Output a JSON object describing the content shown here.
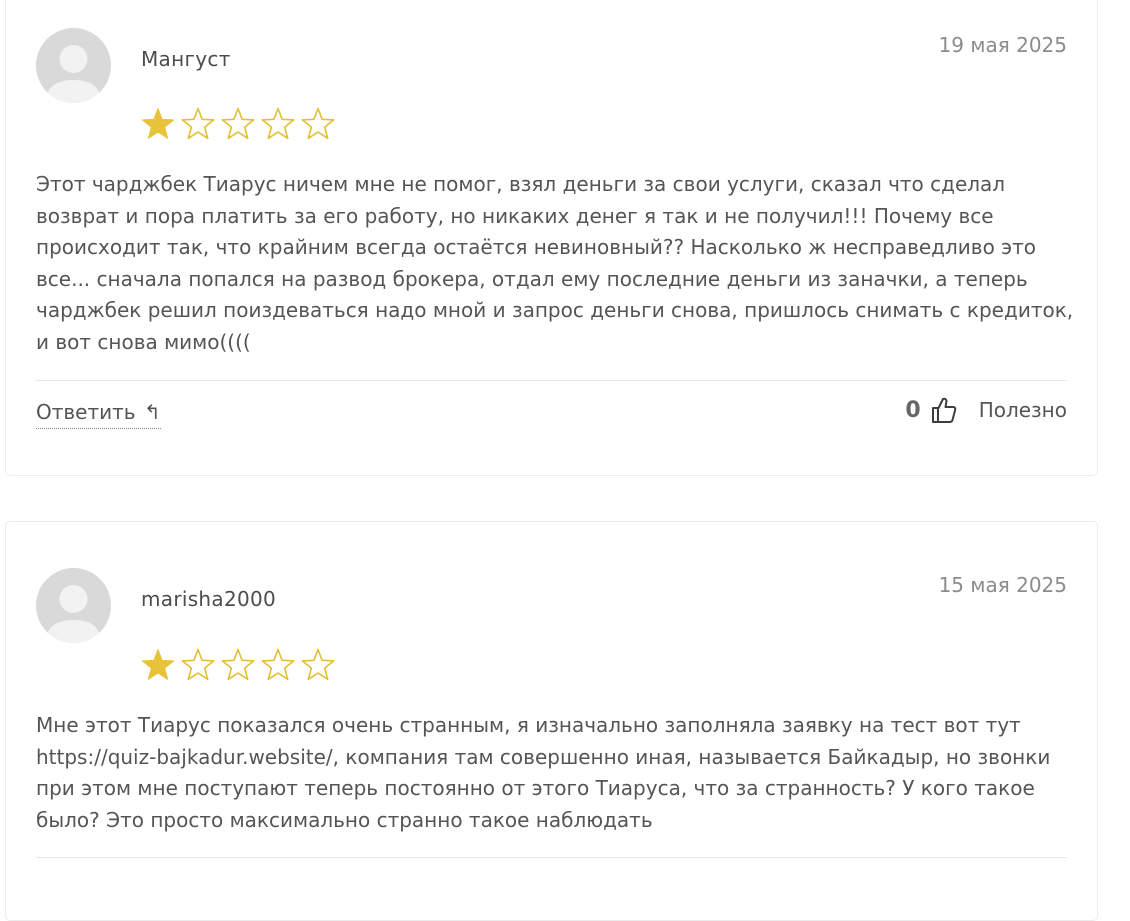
{
  "reviews": [
    {
      "author": "Мангуст",
      "date": "19 мая 2025",
      "rating": 1,
      "rating_max": 5,
      "text": "Этот чарджбек Тиарус ничем мне не помог, взял деньги за свои услуги, сказал что сделал возврат и пора платить за его работу, но никаких денег я так и не получил!!! Почему все происходит так, что крайним всегда остаётся невиновный?? Насколько ж несправедливо это все... сначала попался на развод брокера, отдал ему последние деньги из заначки, а теперь чарджбек решил поиздеваться надо мной и запрос деньги снова, пришлось снимать с кредиток, и вот снова мимо((((",
      "reply_label": "Ответить",
      "reply_icon": "reply-arrow-icon",
      "useful_count": "0",
      "useful_label": "Полезно",
      "useful_icon": "thumbs-up-icon"
    },
    {
      "author": "marisha2000",
      "date": "15 мая 2025",
      "rating": 1,
      "rating_max": 5,
      "text": "Мне этот Тиарус показался очень странным, я изначально заполняла заявку на тест вот тут https://quiz-bajkadur.website/, компания там совершенно иная, называется Байкадыр, но звонки при этом мне поступают теперь постоянно от этого Тиаруса, что за странность? У кого такое было? Это просто максимально странно такое наблюдать"
    }
  ],
  "colors": {
    "star_filled": "#E8C33A",
    "star_empty_stroke": "#E3BE33",
    "avatar_bg": "#D9D9D9",
    "avatar_fg": "#F2F2F2"
  }
}
